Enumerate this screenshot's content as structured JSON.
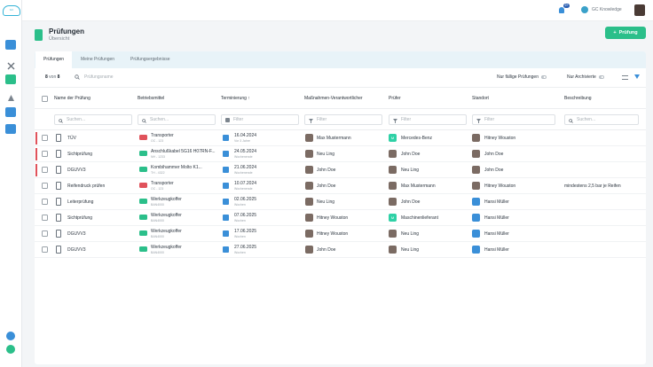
{
  "brand": {
    "logo_text": "GC"
  },
  "topbar": {
    "notifications_badge": "9+",
    "knowledge_label": "GC Knowledge"
  },
  "header": {
    "title": "Prüfungen",
    "subtitle": "Übersicht",
    "add_button": "Prüfung"
  },
  "tabs": [
    {
      "label": "Prüfungen",
      "active": true
    },
    {
      "label": "Meine Prüfungen",
      "active": false
    },
    {
      "label": "Prüfungsergebnisse",
      "active": false
    }
  ],
  "toolbar": {
    "count_current": "8",
    "count_word": "von",
    "count_total": "8",
    "search_placeholder": "Prüfungsname",
    "toggle_due": "Nur fällige Prüfungen",
    "toggle_archived": "Nur Archivierte"
  },
  "columns": [
    "Name der Prüfung",
    "Betriebsmittel",
    "Terminierung",
    "Maßnahmen-Verantwortlicher",
    "Prüfer",
    "Standort",
    "Beschreibung"
  ],
  "filters": {
    "search": "Suchen...",
    "filter": "Filter"
  },
  "rows": [
    {
      "name": "TÜV",
      "flag": true,
      "equip": "Transporter",
      "equip_sub": "OC - 123",
      "equip_color": "#e0525b",
      "date": "16.04.2024",
      "date_sub": "Vor 3 Jahre",
      "resp": "Max Mustermann",
      "resp_type": "photo",
      "tester": "Mercedes-Benz",
      "tester_type": "green",
      "tester_initial": "M",
      "loc": "Hitney Wouston",
      "loc_type": "photo",
      "desc": ""
    },
    {
      "name": "Sichtprüfung",
      "flag": true,
      "equip": "Anschlußkabel 5G16 H07RN-F...",
      "equip_sub": "NH - 1233",
      "equip_color": "#2bbf8a",
      "date": "24.05.2024",
      "date_sub": "Wochenende",
      "resp": "Neu Ling",
      "resp_type": "photo",
      "tester": "John Doe",
      "tester_type": "photo",
      "tester_initial": "",
      "loc": "John Doe",
      "loc_type": "photo",
      "desc": ""
    },
    {
      "name": "DGUVV3",
      "flag": true,
      "equip": "Kombihammer Molto K1...",
      "equip_sub": "TH - 4322",
      "equip_color": "#2bbf8a",
      "date": "21.06.2024",
      "date_sub": "Wochenende",
      "resp": "John Doe",
      "resp_type": "photo",
      "tester": "Neu Ling",
      "tester_type": "photo",
      "tester_initial": "",
      "loc": "John Doe",
      "loc_type": "photo",
      "desc": ""
    },
    {
      "name": "Reifendruck prüfen",
      "flag": false,
      "equip": "Transporter",
      "equip_sub": "OC - 123",
      "equip_color": "#e0525b",
      "date": "10.07.2024",
      "date_sub": "Wochenende",
      "resp": "John Doe",
      "resp_type": "photo",
      "tester": "Max Mustermann",
      "tester_type": "photo",
      "tester_initial": "",
      "loc": "Hitney Wouston",
      "loc_type": "photo",
      "desc": "mindestens 2,5 bar je Reifen"
    },
    {
      "name": "Leiterprüfung",
      "flag": false,
      "equip": "Werkzeugkoffer",
      "equip_sub": "BAN4000",
      "equip_color": "#2bbf8a",
      "date": "02.06.2025",
      "date_sub": "Wochen",
      "resp": "Neu Ling",
      "resp_type": "photo",
      "tester": "John Doe",
      "tester_type": "photo",
      "tester_initial": "",
      "loc": "Hansi Müller",
      "loc_type": "blue",
      "desc": ""
    },
    {
      "name": "Sichtprüfung",
      "flag": false,
      "equip": "Werkzeugkoffer",
      "equip_sub": "BAN4000",
      "equip_color": "#2bbf8a",
      "date": "07.06.2025",
      "date_sub": "Wochen",
      "resp": "Hitney Wouston",
      "resp_type": "photo",
      "tester": "Maschinenlieferant",
      "tester_type": "green",
      "tester_initial": "M",
      "loc": "Hansi Müller",
      "loc_type": "blue",
      "desc": ""
    },
    {
      "name": "DGUVV3",
      "flag": false,
      "equip": "Werkzeugkoffer",
      "equip_sub": "BAN4000",
      "equip_color": "#2bbf8a",
      "date": "17.06.2025",
      "date_sub": "Wochen",
      "resp": "Hitney Wouston",
      "resp_type": "photo",
      "tester": "Neu Ling",
      "tester_type": "photo",
      "tester_initial": "",
      "loc": "Hansi Müller",
      "loc_type": "blue",
      "desc": ""
    },
    {
      "name": "DGUVV3",
      "flag": false,
      "equip": "Werkzeugkoffer",
      "equip_sub": "BAN4000",
      "equip_color": "#2bbf8a",
      "date": "27.06.2025",
      "date_sub": "Wochen",
      "resp": "John Doe",
      "resp_type": "photo",
      "tester": "Neu Ling",
      "tester_type": "photo",
      "tester_initial": "",
      "loc": "Hansi Müller",
      "loc_type": "blue",
      "desc": ""
    }
  ]
}
